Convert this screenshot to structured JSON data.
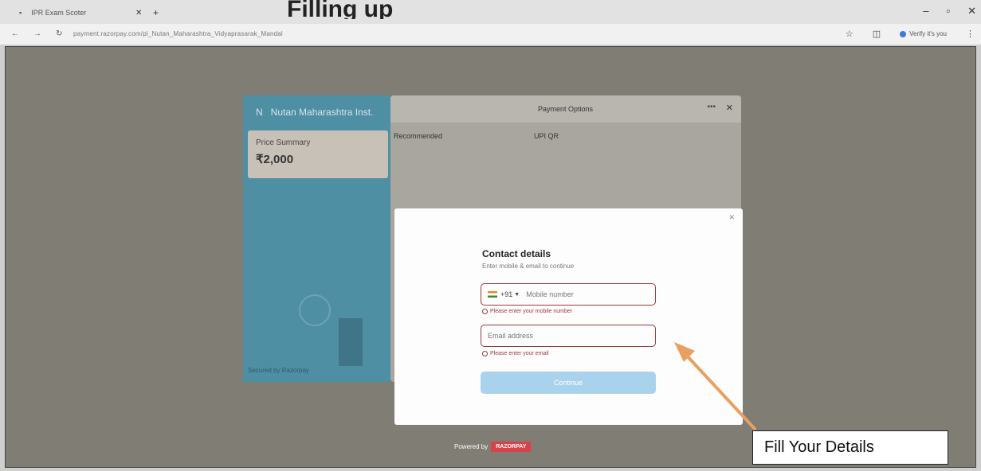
{
  "browser": {
    "tab_title": "IPR Exam Scoter",
    "url": "payment.razorpay.com/pl_Nutan_Maharashtra_Vidyaprasarak_Mandal",
    "verify_label": "Verify it's you",
    "background_title": "Filling up"
  },
  "merchant": {
    "initial": "N",
    "name": "Nutan Maharashtra Inst."
  },
  "price_summary": {
    "label": "Price Summary",
    "value": "₹2,000"
  },
  "left_footer": "Secured by Razorpay",
  "payment_options": {
    "title": "Payment Options",
    "recommended": "Recommended",
    "upi": "UPI QR"
  },
  "contact": {
    "title": "Contact details",
    "subtitle": "Enter mobile & email to continue",
    "country_code": "+91",
    "phone_placeholder": "Mobile number",
    "phone_error": "Please enter your mobile number",
    "email_placeholder": "Email address",
    "email_error": "Please enter your email",
    "continue_label": "Continue"
  },
  "footer": {
    "powered_by": "Powered by",
    "brand": "RAZORPAY"
  },
  "annotation": {
    "callout": "Fill Your Details",
    "color": "#e8a060"
  }
}
